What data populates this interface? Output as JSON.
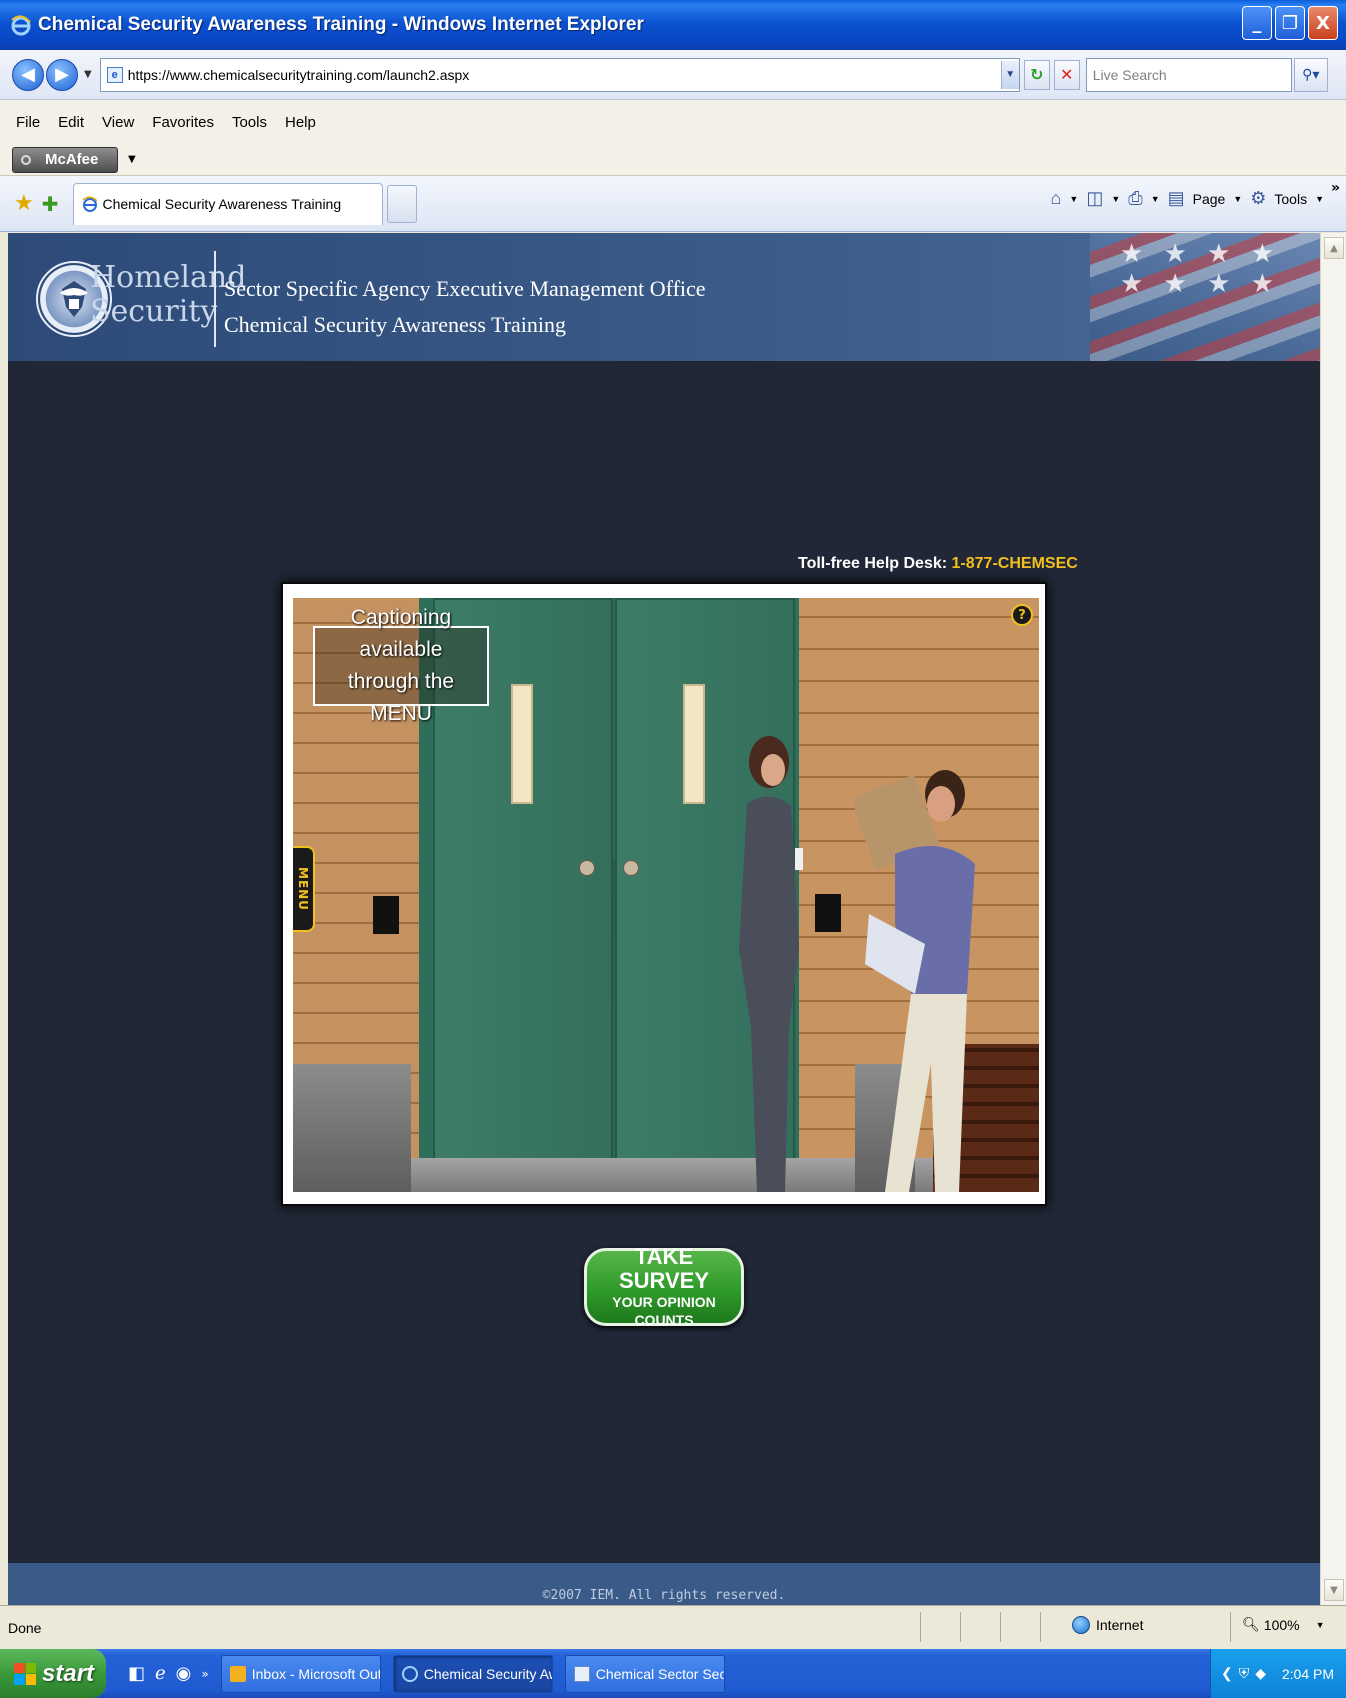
{
  "window": {
    "title": "Chemical Security Awareness Training - Windows Internet Explorer",
    "buttons": {
      "minimize": "_",
      "maximize": "❐",
      "close": "X"
    }
  },
  "address_bar": {
    "url": "https://www.chemicalsecuritytraining.com/launch2.aspx",
    "search_placeholder": "Live Search"
  },
  "menu": {
    "items": [
      "File",
      "Edit",
      "View",
      "Favorites",
      "Tools",
      "Help"
    ]
  },
  "toolbar": {
    "mcafee_label": "McAfee"
  },
  "tabs": {
    "active_tab": "Chemical Security Awareness Training",
    "commands": {
      "page": "Page",
      "tools": "Tools"
    }
  },
  "page": {
    "header": {
      "org_line1": "Homeland",
      "org_line2": "Security",
      "office_line1": "Sector Specific Agency Executive Management Office",
      "office_line2": "Chemical Security Awareness Training"
    },
    "helpdesk": {
      "label": "Toll-free Help Desk:",
      "phone": "1-877-CHEMSEC"
    },
    "player": {
      "caption_line1": "Captioning available",
      "caption_line2": "through the MENU",
      "menu_tab": "MENU",
      "help_label": "?"
    },
    "survey": {
      "line1": "TAKE SURVEY",
      "line2": "YOUR OPINION COUNTS"
    },
    "footer": "©2007 IEM. All rights reserved."
  },
  "status_bar": {
    "status": "Done",
    "zone": "Internet",
    "zoom": "100%"
  },
  "taskbar": {
    "start_label": "start",
    "tasks": [
      {
        "label": "Inbox - Microsoft Out..."
      },
      {
        "label": "Chemical Security Aw..."
      },
      {
        "label": "Chemical Sector Secu..."
      }
    ],
    "clock": "2:04 PM"
  },
  "colors": {
    "accent_yellow": "#f2c01e",
    "page_background": "#212736",
    "header_blue": "#3a5a88",
    "survey_green": "#2f9a2a"
  }
}
